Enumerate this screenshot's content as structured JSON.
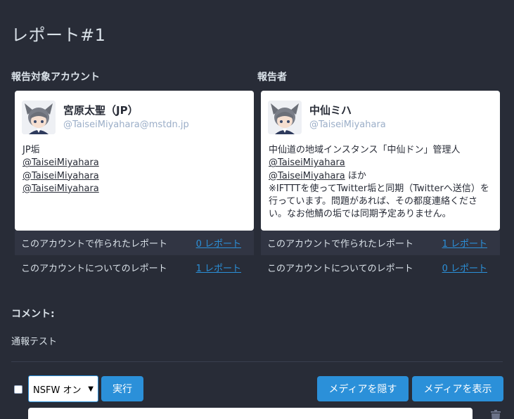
{
  "page_title": "レポート#1",
  "target_section_label": "報告対象アカウント",
  "reporter_section_label": "報告者",
  "target_account": {
    "display_name": "宮原太聖（JP）",
    "acct": "@TaiseiMiyahara@mstdn.jp",
    "bio_lines": [
      "JP垢"
    ],
    "mentions": [
      "@TaiseiMiyahara",
      "@TaiseiMiyahara",
      "@TaiseiMiyahara"
    ],
    "stats": [
      {
        "label": "このアカウントで作られたレポート",
        "link": "0 レポート"
      },
      {
        "label": "このアカウントについてのレポート",
        "link": "1 レポート"
      }
    ]
  },
  "reporter_account": {
    "display_name": "中仙ミハ",
    "acct": "@TaiseiMiyahara",
    "bio_line1": "中仙道の地域インスタンス「中仙ドン」管理人",
    "mention1": "@TaiseiMiyahara",
    "mention2": "@TaiseiMiyahara",
    "mention2_suffix": " ほか",
    "bio_line2": "※IFTTTを使ってTwitter垢と同期（Twitterへ送信）を行っています。問題があれば、その都度連絡ください。なお他鯖の垢では同期予定ありません。",
    "stats": [
      {
        "label": "このアカウントで作られたレポート",
        "link": "1 レポート"
      },
      {
        "label": "このアカウントについてのレポート",
        "link": "0 レポート"
      }
    ]
  },
  "comment_label": "コメント:",
  "comment_text": "通報テスト",
  "actions": {
    "select_value": "NSFW オン",
    "execute_label": "実行",
    "hide_media_label": "メディアを隠す",
    "show_media_label": "メディアを表示"
  },
  "icons": {
    "trash": "trash-icon",
    "caret": "caret-down-icon"
  },
  "colors": {
    "background": "#282c37",
    "accent": "#2b90d9",
    "card": "#ffffff",
    "muted": "#9baec8"
  }
}
